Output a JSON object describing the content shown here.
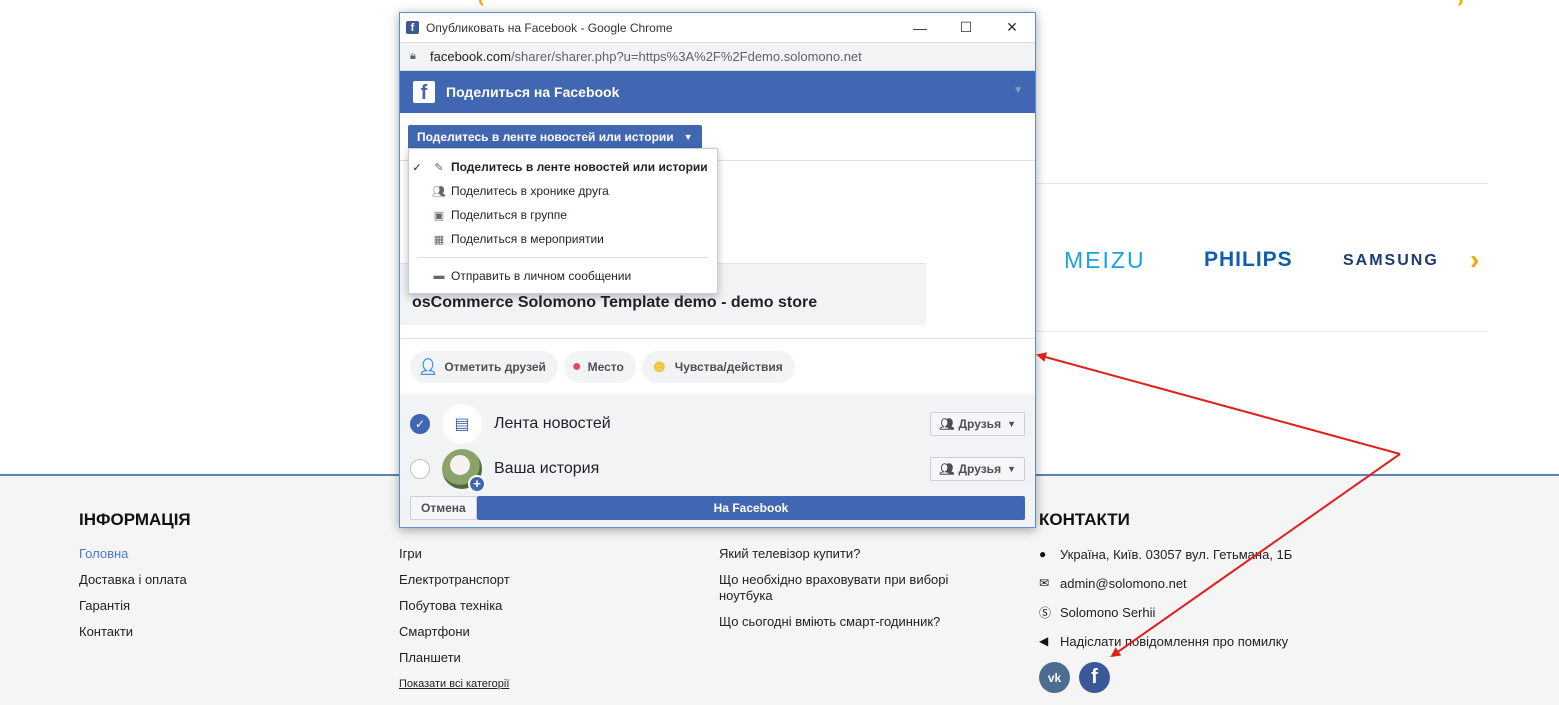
{
  "popup": {
    "window_title": "Опубликовать на Facebook - Google Chrome",
    "url_domain": "facebook.com",
    "url_path": "/sharer/sharer.php?u=https%3A%2F%2Fdemo.solomono.net",
    "header_title": "Поделиться на Facebook",
    "share_select": "Поделитесь в ленте новостей или истории",
    "menu": {
      "items": [
        {
          "label": "Поделитесь в ленте новостей или истории",
          "icon": "edit-icon",
          "selected": true
        },
        {
          "label": "Поделитесь в хронике друга",
          "icon": "friends-icon"
        },
        {
          "label": "Поделиться в группе",
          "icon": "group-icon"
        },
        {
          "label": "Поделиться в мероприятии",
          "icon": "calendar-icon"
        }
      ],
      "message_item": "Отправить в личном сообщении"
    },
    "link_title": "osCommerce Solomono Template demo - demo store",
    "actions": {
      "tag_friends": "Отметить друзей",
      "place": "Место",
      "feelings": "Чувства/действия"
    },
    "targets": [
      {
        "label": "Лента новостей",
        "audience": "Друзья",
        "checked": true
      },
      {
        "label": "Ваша история",
        "audience": "Друзья",
        "checked": false
      }
    ],
    "cancel_label": "Отмена",
    "post_label": "На Facebook"
  },
  "brands": {
    "meizu": "MEIZU",
    "philips": "PHILIPS",
    "samsung": "SAMSUNG"
  },
  "footer": {
    "info": {
      "title": "ІНФОРМАЦІЯ",
      "links": [
        "Головна",
        "Доставка і оплата",
        "Гарантія",
        "Контакти"
      ]
    },
    "categories": {
      "links": [
        "Ігри",
        "Електротранспорт",
        "Побутова техніка",
        "Смартфони",
        "Планшети"
      ],
      "all_link": "Показати всі категорії"
    },
    "articles": {
      "links": [
        "Який телевізор купити?",
        "Що необхідно враховувати при виборі ноутбука",
        "Що сьогодні вміють смарт-годинник?"
      ]
    },
    "contacts": {
      "title": "КОНТАКТИ",
      "address": "Україна, Київ. 03057 вул. Гетьмана, 1Б",
      "email": "admin@solomono.net",
      "skype": "Solomono Serhii",
      "report": "Надіслати повідомлення про помилку"
    },
    "socials": {
      "vk": "vk",
      "fb": "f"
    }
  },
  "colors": {
    "facebook_blue": "#4267b2",
    "annotation_red": "#e0201b",
    "brand_orange": "#f2a900",
    "footer_bg": "#f5f5f5"
  }
}
